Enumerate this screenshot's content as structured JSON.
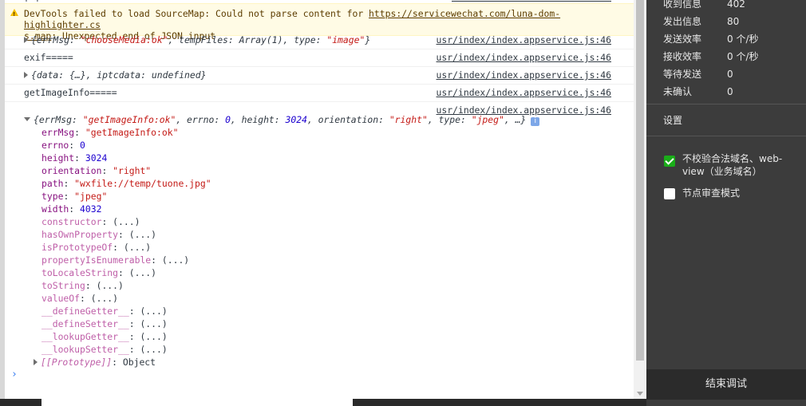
{
  "console": {
    "top_cut_text": "[ ] ...",
    "warning": {
      "prefix": "DevTools failed to load SourceMap: Could not parse content for ",
      "link": "https://servicewechat.com/luna-dom-highlighter.css.map",
      "link_line1": "https://servicewechat.com/luna-dom-highlighter.cs",
      "link_line2": "s.map",
      "suffix": ": Unexpected end of JSON input"
    },
    "source": "usr/index/index.appservice.js:46",
    "rows": [
      {
        "type": "object",
        "parts": [
          {
            "t": "{errMsg: ",
            "c": ""
          },
          {
            "t": "\"chooseMedia:ok\"",
            "c": "str"
          },
          {
            "t": ", tempFiles: Array(1), type: ",
            "c": ""
          },
          {
            "t": "\"image\"",
            "c": "str"
          },
          {
            "t": "}",
            "c": ""
          }
        ]
      },
      {
        "type": "text",
        "text": "exif====="
      },
      {
        "type": "object",
        "parts": [
          {
            "t": "{data: {…}, iptcdata: undefined}",
            "c": ""
          }
        ]
      },
      {
        "type": "text",
        "text": "getImageInfo====="
      }
    ],
    "expanded_header": [
      {
        "t": "{errMsg: ",
        "c": ""
      },
      {
        "t": "\"getImageInfo:ok\"",
        "c": "str"
      },
      {
        "t": ", errno: ",
        "c": ""
      },
      {
        "t": "0",
        "c": "num"
      },
      {
        "t": ", height: ",
        "c": ""
      },
      {
        "t": "3024",
        "c": "num"
      },
      {
        "t": ", orientation: ",
        "c": ""
      },
      {
        "t": "\"right\"",
        "c": "str"
      },
      {
        "t": ", type: ",
        "c": ""
      },
      {
        "t": "\"jpeg\"",
        "c": "str"
      },
      {
        "t": ", …}",
        "c": ""
      }
    ],
    "info_badge": "i",
    "properties": [
      {
        "k": "errMsg",
        "v": "\"getImageInfo:ok\"",
        "vc": "str",
        "dim": false
      },
      {
        "k": "errno",
        "v": "0",
        "vc": "num",
        "dim": false
      },
      {
        "k": "height",
        "v": "3024",
        "vc": "num",
        "dim": false
      },
      {
        "k": "orientation",
        "v": "\"right\"",
        "vc": "str",
        "dim": false
      },
      {
        "k": "path",
        "v": "\"wxfile://temp/tuone.jpg\"",
        "vc": "str",
        "dim": false
      },
      {
        "k": "type",
        "v": "\"jpeg\"",
        "vc": "str",
        "dim": false
      },
      {
        "k": "width",
        "v": "4032",
        "vc": "num",
        "dim": false
      },
      {
        "k": "constructor",
        "v": "(...)",
        "vc": "",
        "dim": true
      },
      {
        "k": "hasOwnProperty",
        "v": "(...)",
        "vc": "",
        "dim": true
      },
      {
        "k": "isPrototypeOf",
        "v": "(...)",
        "vc": "",
        "dim": true
      },
      {
        "k": "propertyIsEnumerable",
        "v": "(...)",
        "vc": "",
        "dim": true
      },
      {
        "k": "toLocaleString",
        "v": "(...)",
        "vc": "",
        "dim": true
      },
      {
        "k": "toString",
        "v": "(...)",
        "vc": "",
        "dim": true
      },
      {
        "k": "valueOf",
        "v": "(...)",
        "vc": "",
        "dim": true
      },
      {
        "k": "__defineGetter__",
        "v": "(...)",
        "vc": "",
        "dim": true
      },
      {
        "k": "__defineSetter__",
        "v": "(...)",
        "vc": "",
        "dim": true
      },
      {
        "k": "__lookupGetter__",
        "v": "(...)",
        "vc": "",
        "dim": true
      },
      {
        "k": "__lookupSetter__",
        "v": "(...)",
        "vc": "",
        "dim": true
      }
    ],
    "prototype": {
      "k": "[[Prototype]]",
      "v": "Object"
    },
    "prompt_glyph": "›"
  },
  "panel": {
    "stats": [
      {
        "label": "收到信息",
        "value": "402"
      },
      {
        "label": "发出信息",
        "value": "80"
      },
      {
        "label": "发送效率",
        "value": "0 个/秒"
      },
      {
        "label": "接收效率",
        "value": "0 个/秒"
      },
      {
        "label": "等待发送",
        "value": "0"
      },
      {
        "label": "未确认",
        "value": "0"
      }
    ],
    "settings_title": "设置",
    "options": [
      {
        "label": "不校验合法域名、web-view（业务域名）",
        "checked": true
      },
      {
        "label": "节点审查模式",
        "checked": false
      }
    ],
    "end_button": "结束调试"
  },
  "colors": {
    "string": "#c41a16",
    "number": "#1c00cf",
    "key": "#881280",
    "warning_bg": "#fffbe5",
    "checkbox_on": "#1aad19",
    "panel_bg": "#3c3c3c"
  }
}
